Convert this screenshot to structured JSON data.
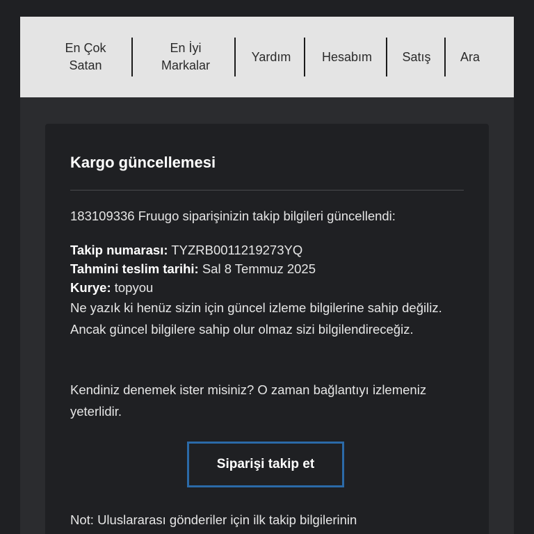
{
  "nav": {
    "items": [
      {
        "line1": "En Çok",
        "line2": "Satan"
      },
      {
        "line1": "En İyi",
        "line2": "Markalar"
      },
      {
        "line1": "Yardım",
        "line2": ""
      },
      {
        "line1": "Hesabım",
        "line2": ""
      },
      {
        "line1": "Satış",
        "line2": ""
      },
      {
        "line1": "Ara",
        "line2": ""
      }
    ]
  },
  "card": {
    "title": "Kargo güncellemesi",
    "intro": "183109336 Fruugo siparişinizin takip bilgileri güncellendi:",
    "tracking_label": "Takip numarası:",
    "tracking_value": "TYZRB0011219273YQ",
    "delivery_label": "Tahmini teslim tarihi:",
    "delivery_value": "Sal 8 Temmuz 2025",
    "courier_label": "Kurye:",
    "courier_value": "topyou",
    "no_info_text": "Ne yazık ki henüz sizin için güncel izleme bilgilerine sahip değiliz. Ancak güncel bilgilere sahip olur olmaz sizi bilgilendireceğiz.",
    "try_text": "Kendiniz denemek ister misiniz? O zaman bağlantıyı izlemeniz yeterlidir.",
    "track_button_label": "Siparişi takip et",
    "note_text": "Not: Uluslararası gönderiler için ilk takip bilgilerinin"
  },
  "colors": {
    "background": "#1f2023",
    "nav_background": "#e4e4e4",
    "button_border": "#2b6aa8"
  }
}
